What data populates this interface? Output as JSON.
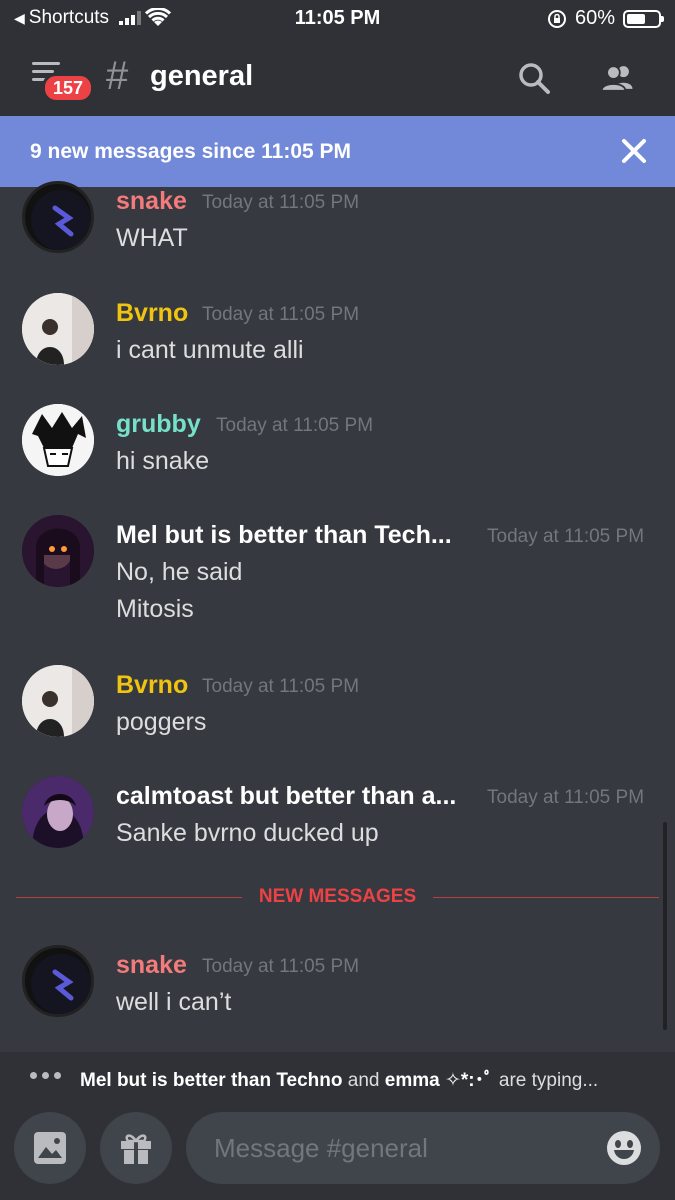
{
  "status_bar": {
    "back_label": "Shortcuts",
    "time": "11:05 PM",
    "battery": "60%",
    "battery_level": 0.6
  },
  "header": {
    "badge_count": "157",
    "hash": "#",
    "channel": "general"
  },
  "new_messages_bar": {
    "text": "9 new messages since 11:05 PM"
  },
  "messages": [
    {
      "author": "snake",
      "author_color": "#f47b7b",
      "time": "Today at 11:05 PM",
      "lines": [
        "WHAT"
      ]
    },
    {
      "author": "Bvrno",
      "author_color": "#f1c40f",
      "time": "Today at 11:05 PM",
      "lines": [
        "i cant unmute alli"
      ]
    },
    {
      "author": "grubby",
      "author_color": "#76e0c8",
      "time": "Today at 11:05 PM",
      "lines": [
        "hi snake"
      ]
    },
    {
      "author": "Mel but is better than Tech...",
      "author_color": "#ffffff",
      "time": "Today at 11:05 PM",
      "lines": [
        "No, he said",
        "Mitosis"
      ]
    },
    {
      "author": "Bvrno",
      "author_color": "#f1c40f",
      "time": "Today at 11:05 PM",
      "lines": [
        "poggers"
      ]
    },
    {
      "author": "calmtoast but better than a...",
      "author_color": "#ffffff",
      "time": "Today at 11:05 PM",
      "lines": [
        "Sanke bvrno ducked up"
      ]
    },
    {
      "author": "snake",
      "author_color": "#f47b7b",
      "time": "Today at 11:05 PM",
      "lines": [
        "well i can’t"
      ]
    }
  ],
  "divider_label": "NEW MESSAGES",
  "typing": {
    "user1": "Mel but is better than Techno",
    "and": "and",
    "user2": "emma ✧*:･ﾟ",
    "suffix": "are typing..."
  },
  "composer": {
    "placeholder": "Message #general"
  }
}
